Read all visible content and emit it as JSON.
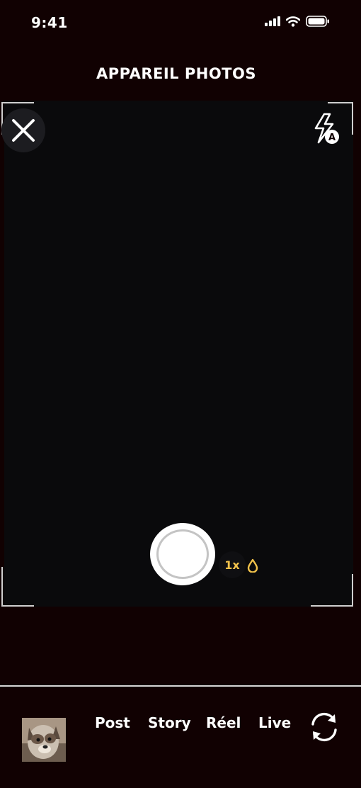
{
  "status_bar": {
    "time": "9:41",
    "icons": [
      "signal-icon",
      "wifi-icon",
      "battery-icon"
    ]
  },
  "header": {
    "title": "APPAREIL PHOTOS"
  },
  "camera": {
    "close_icon": "close-icon",
    "flash_icon": "flash-auto-icon",
    "zoom_label": "1x",
    "zoom_accent": "#f2c24b",
    "drop_icon": "drop-icon"
  },
  "bottom_bar": {
    "gallery_icon": "gallery-thumbnail",
    "modes": [
      "Post",
      "Story",
      "Réel",
      "Live"
    ],
    "flip_icon": "flip-camera-icon"
  },
  "colors": {
    "background": "#110102",
    "viewfinder": "#0a0a0c",
    "text": "#ffffff",
    "accent": "#f2c24b"
  }
}
